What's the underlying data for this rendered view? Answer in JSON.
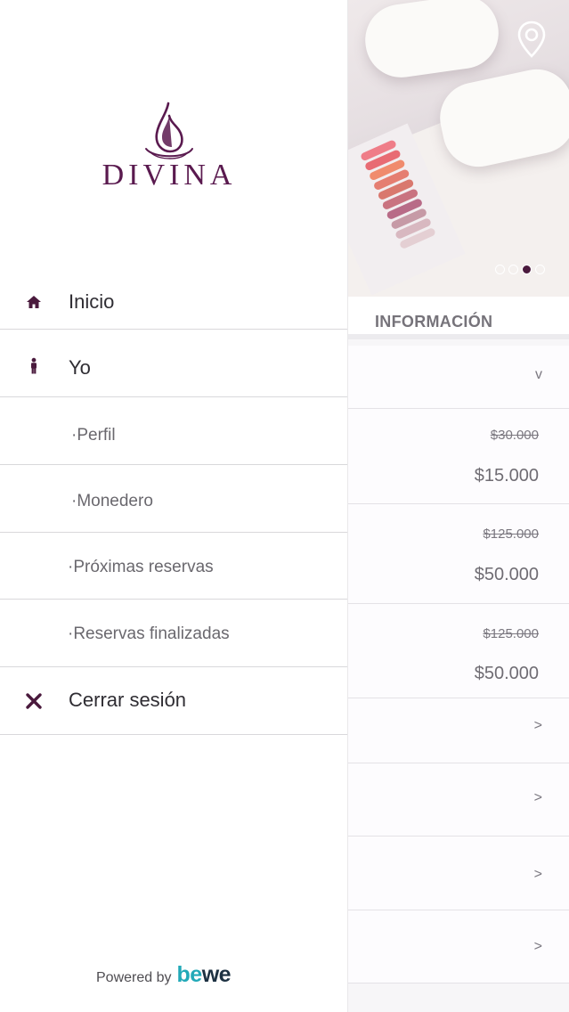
{
  "brand": {
    "name": "DIVINA",
    "accent_color": "#5a1a4f",
    "logo_icon": "drop-logo-icon"
  },
  "drawer": {
    "menu": [
      {
        "label": "Inicio",
        "icon": "home-icon"
      },
      {
        "label": "Yo",
        "icon": "person-icon"
      },
      {
        "label": "·Perfil"
      },
      {
        "label": "·Monedero"
      },
      {
        "label": "·Próximas reservas"
      },
      {
        "label": "·Reservas finalizadas"
      },
      {
        "label": "Cerrar sesión",
        "icon": "close-icon"
      }
    ],
    "footer": {
      "powered_by": "Powered by",
      "provider_logo": "bewe"
    }
  },
  "background_page": {
    "hero": {
      "carousel_total": 4,
      "carousel_active_index": 2,
      "location_icon": "location-pin-icon"
    },
    "section_title": "INFORMACIÓN",
    "collapse_icon": "v",
    "services": [
      {
        "old_price": "$30.000",
        "new_price": "$15.000"
      },
      {
        "old_price": "$125.000",
        "new_price": "$50.000"
      },
      {
        "old_price": "$125.000",
        "new_price": "$50.000"
      }
    ],
    "link_rows": [
      {
        "chevron": ">"
      },
      {
        "chevron": ">"
      },
      {
        "chevron": ">"
      },
      {
        "chevron": ">"
      }
    ]
  }
}
